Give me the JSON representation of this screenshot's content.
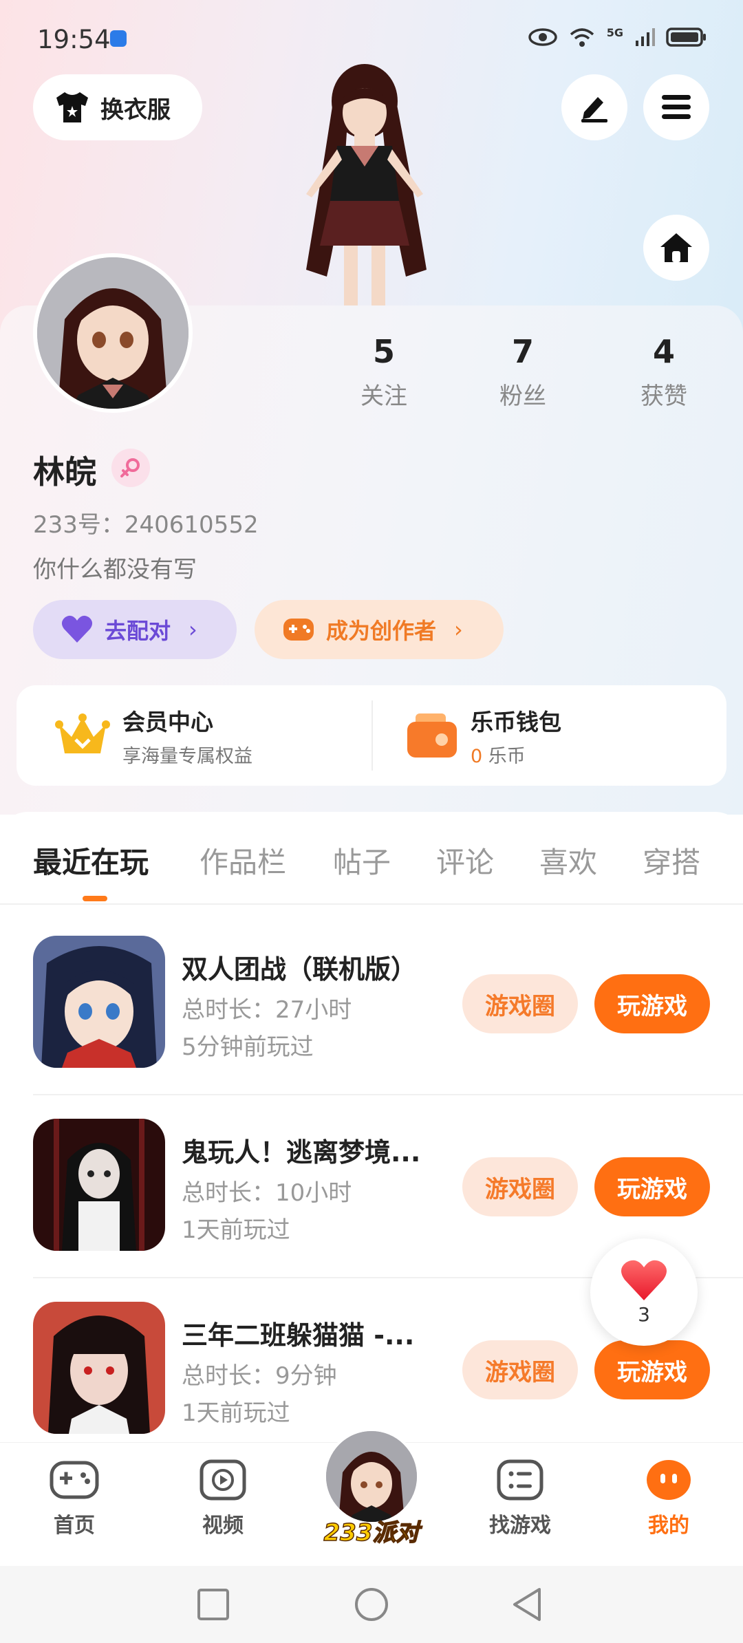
{
  "status": {
    "time": "19:54",
    "network": "5G"
  },
  "header": {
    "outfit_label": "换衣服"
  },
  "profile": {
    "stats": [
      {
        "value": "5",
        "label": "关注"
      },
      {
        "value": "7",
        "label": "粉丝"
      },
      {
        "value": "4",
        "label": "获赞"
      }
    ],
    "name": "林皖",
    "uid": "233号：240610552",
    "bio": "你什么都没有写",
    "match_label": "去配对",
    "creator_label": "成为创作者"
  },
  "vip": {
    "member_title": "会员中心",
    "member_sub": "享海量专属权益",
    "wallet_title": "乐币钱包",
    "wallet_amount": "0",
    "wallet_unit": "乐币"
  },
  "tabs": [
    "最近在玩",
    "作品栏",
    "帖子",
    "评论",
    "喜欢",
    "穿搭"
  ],
  "games": [
    {
      "name": "双人团战（联机版）",
      "duration": "总时长：27小时",
      "last_played": "5分钟前玩过",
      "circle_label": "游戏圈",
      "play_label": "玩游戏"
    },
    {
      "name": "鬼玩人！逃离梦境...",
      "duration": "总时长：10小时",
      "last_played": "1天前玩过",
      "circle_label": "游戏圈",
      "play_label": "玩游戏"
    },
    {
      "name": "三年二班躲猫猫 -...",
      "duration": "总时长：9分钟",
      "last_played": "1天前玩过",
      "circle_label": "游戏圈",
      "play_label": "玩游戏"
    }
  ],
  "like_bubble": {
    "count": "3"
  },
  "bottom_nav": {
    "home": "首页",
    "video": "视频",
    "center": "233派对",
    "find": "找游戏",
    "mine": "我的"
  },
  "colors": {
    "accent": "#ff6f12",
    "accent_light": "#fde6da",
    "match_bg": "#e3dcf6",
    "match_text": "#6b4ad6"
  }
}
